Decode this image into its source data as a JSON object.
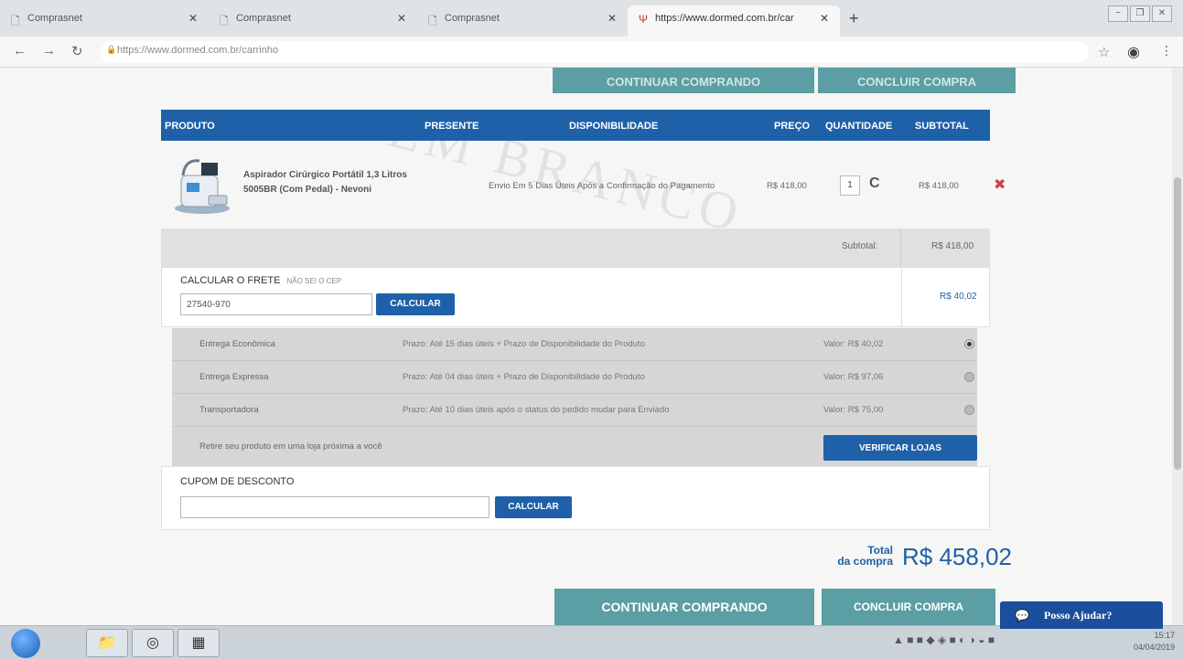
{
  "browser": {
    "tabs": [
      {
        "title": "Comprasnet",
        "active": false
      },
      {
        "title": "Comprasnet",
        "active": false
      },
      {
        "title": "Comprasnet",
        "active": false
      },
      {
        "title": "https://www.dormed.com.br/car",
        "active": true
      }
    ],
    "url": "https://www.dormed.com.br/carrinho",
    "window_controls": [
      "−",
      "❐",
      "✕"
    ]
  },
  "cart": {
    "top_buttons": {
      "continuar": "CONTINUAR COMPRANDO",
      "concluir": "CONCLUIR COMPRA"
    },
    "watermark": "EM BRANCO",
    "headers": {
      "produto": "PRODUTO",
      "presente": "PRESENTE",
      "disponibilidade": "DISPONIBILIDADE",
      "preco": "PREÇO",
      "quantidade": "QUANTIDADE",
      "subtotal": "SUBTOTAL"
    },
    "item": {
      "name": "Aspirador Cirúrgico Portátil 1,3 Litros 5005BR (Com Pedal) - Nevoni",
      "availability": "Envio Em 5 Dias Úteis Após a Confirmação do Pagamento",
      "price": "R$ 418,00",
      "quantity": "1",
      "subtotal": "R$ 418,00"
    },
    "subtotal": {
      "label": "Subtotal:",
      "value": "R$ 418,00"
    },
    "frete": {
      "title": "CALCULAR O FRETE",
      "cep_link": "NÃO SEI O CEP",
      "cep_value": "27540-970",
      "button": "CALCULAR",
      "value": "R$ 40,02"
    },
    "shipping_options": [
      {
        "name": "Entrega Econômica",
        "prazo": "Prazo: Até 15 dias úteis + Prazo de Disponibilidade do Produto",
        "valor": "Valor: R$ 40,02",
        "selected": true
      },
      {
        "name": "Entrega Expressa",
        "prazo": "Prazo: Até 04 dias úteis + Prazo de Disponibilidade do Produto",
        "valor": "Valor: R$ 97,06",
        "selected": false
      },
      {
        "name": "Transportadora",
        "prazo": "Prazo: Até 10 dias úteis após o status do pedido mudar para Enviado",
        "valor": "Valor: R$ 75,00",
        "selected": false
      }
    ],
    "retire": {
      "text": "Retire seu produto em uma loja próxima a você",
      "button": "VERIFICAR LOJAS"
    },
    "cupom": {
      "title": "CUPOM DE DESCONTO",
      "value": "",
      "button": "CALCULAR"
    },
    "total": {
      "label_top": "Total",
      "label_bottom": "da compra",
      "value": "R$ 458,02"
    },
    "bottom_buttons": {
      "continuar": "CONTINUAR COMPRANDO",
      "concluir": "CONCLUIR COMPRA"
    }
  },
  "chat": {
    "label": "Posso Ajudar?"
  },
  "taskbar": {
    "clock_time": "15:17",
    "clock_date": "04/04/2019"
  },
  "colors": {
    "primary": "#1f61a8",
    "teal": "#5b9ea3",
    "remove": "#d0434a"
  }
}
